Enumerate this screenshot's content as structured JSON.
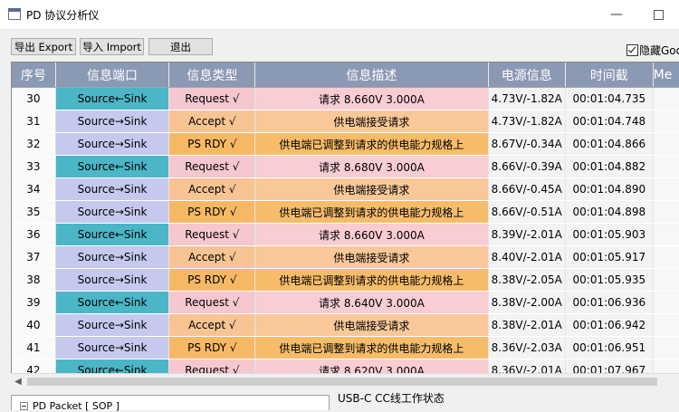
{
  "window": {
    "title": "PD 协议分析仪",
    "minimize": "—"
  },
  "toolbar": {
    "export_label": "导出 Export",
    "import_label": "导入 Import",
    "exit_label": "退出",
    "hide_label": "隐藏Goo"
  },
  "table": {
    "headers": [
      "序号",
      "信息端口",
      "信息类型",
      "信息描述",
      "电源信息",
      "时间截",
      "Me"
    ],
    "rows": [
      {
        "seq": "30",
        "port": "Source←Sink",
        "type": "Request √",
        "desc": "请求 8.660V 3.000A",
        "power": "4.73V/-1.82A",
        "time": "00:01:04.735",
        "kind": "request"
      },
      {
        "seq": "31",
        "port": "Source→Sink",
        "type": "Accept √",
        "desc": "供电端接受请求",
        "power": "4.73V/-1.82A",
        "time": "00:01:04.748",
        "kind": "accept"
      },
      {
        "seq": "32",
        "port": "Source→Sink",
        "type": "PS RDY √",
        "desc": "供电端已调整到请求的供电能力规格上",
        "power": "8.67V/-0.34A",
        "time": "00:01:04.866",
        "kind": "psrdy"
      },
      {
        "seq": "33",
        "port": "Source←Sink",
        "type": "Request √",
        "desc": "请求 8.680V 3.000A",
        "power": "8.66V/-0.39A",
        "time": "00:01:04.882",
        "kind": "request"
      },
      {
        "seq": "34",
        "port": "Source→Sink",
        "type": "Accept √",
        "desc": "供电端接受请求",
        "power": "8.66V/-0.45A",
        "time": "00:01:04.890",
        "kind": "accept"
      },
      {
        "seq": "35",
        "port": "Source→Sink",
        "type": "PS RDY √",
        "desc": "供电端已调整到请求的供电能力规格上",
        "power": "8.66V/-0.51A",
        "time": "00:01:04.898",
        "kind": "psrdy"
      },
      {
        "seq": "36",
        "port": "Source←Sink",
        "type": "Request √",
        "desc": "请求 8.660V 3.000A",
        "power": "8.39V/-2.01A",
        "time": "00:01:05.903",
        "kind": "request"
      },
      {
        "seq": "37",
        "port": "Source→Sink",
        "type": "Accept √",
        "desc": "供电端接受请求",
        "power": "8.40V/-2.01A",
        "time": "00:01:05.917",
        "kind": "accept"
      },
      {
        "seq": "38",
        "port": "Source→Sink",
        "type": "PS RDY √",
        "desc": "供电端已调整到请求的供电能力规格上",
        "power": "8.38V/-2.05A",
        "time": "00:01:05.935",
        "kind": "psrdy"
      },
      {
        "seq": "39",
        "port": "Source←Sink",
        "type": "Request √",
        "desc": "请求 8.640V 3.000A",
        "power": "8.38V/-2.00A",
        "time": "00:01:06.936",
        "kind": "request"
      },
      {
        "seq": "40",
        "port": "Source→Sink",
        "type": "Accept √",
        "desc": "供电端接受请求",
        "power": "8.38V/-2.01A",
        "time": "00:01:06.942",
        "kind": "accept"
      },
      {
        "seq": "41",
        "port": "Source→Sink",
        "type": "PS RDY √",
        "desc": "供电端已调整到请求的供电能力规格上",
        "power": "8.36V/-2.03A",
        "time": "00:01:06.951",
        "kind": "psrdy"
      },
      {
        "seq": "42",
        "port": "Source←Sink",
        "type": "Request √",
        "desc": "请求 8.620V 3.000A",
        "power": "8.36V/-2.01A",
        "time": "00:01:07.967",
        "kind": "request"
      }
    ]
  },
  "colors": {
    "port_request": "#4bb6c6",
    "port_other": "#c6c9ee",
    "type_request": "#f6c7cf",
    "type_accept": "#f7c493",
    "type_psrdy": "#f7b865",
    "desc_request": "#f9cdd3",
    "desc_accept": "#f8c898",
    "desc_psrdy": "#f6bc6a"
  },
  "bottom": {
    "tree_label": "PD Packet [ SOP ]",
    "cc_status": "USB-C CC线工作状态"
  }
}
